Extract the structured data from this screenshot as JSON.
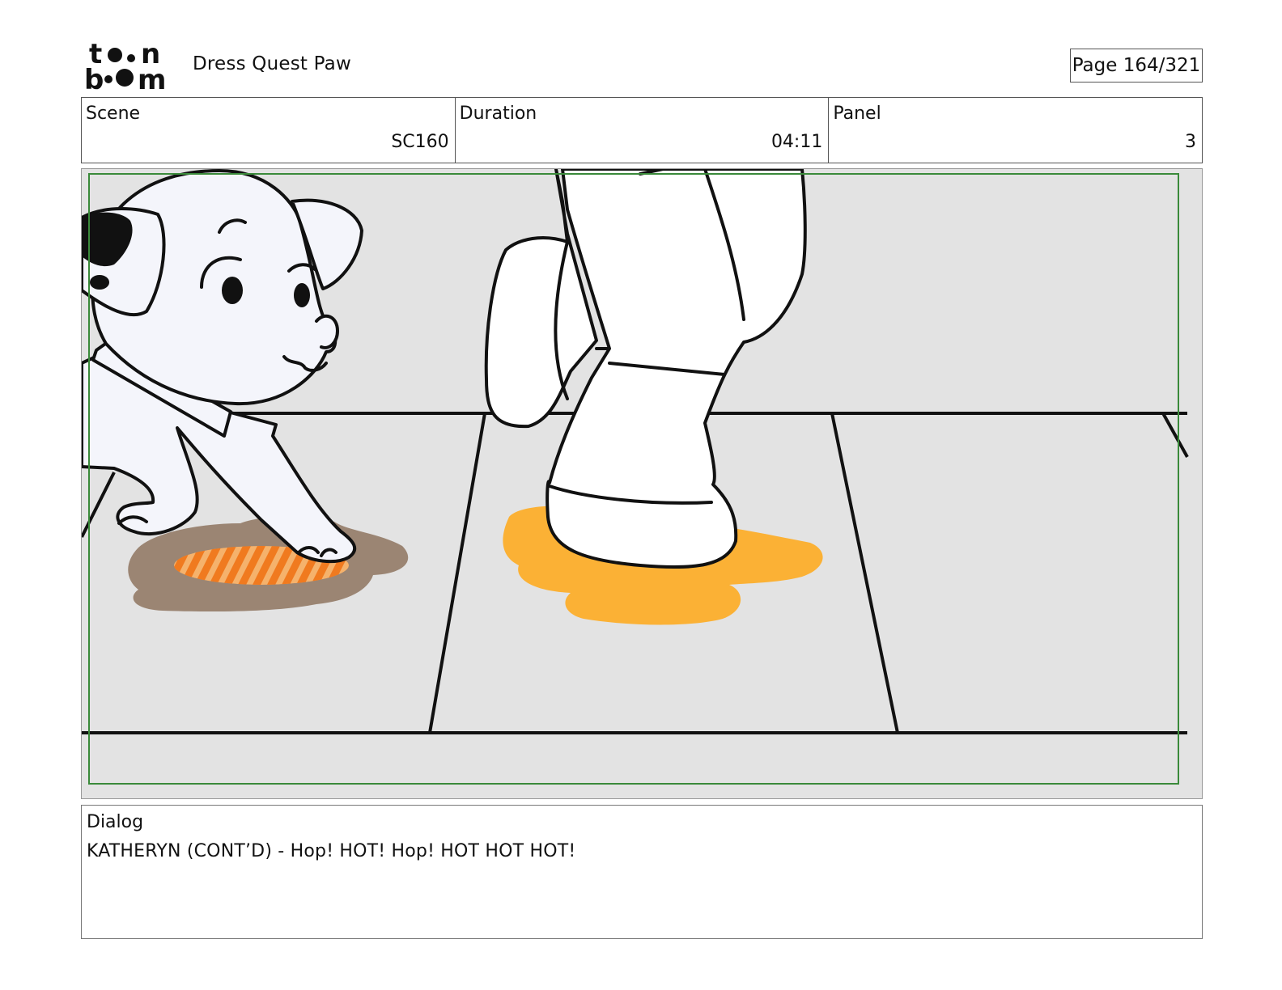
{
  "header": {
    "logo_text": "toon boom",
    "project_title": "Dress Quest Paw",
    "page_label": "Page 164/321"
  },
  "info": {
    "scene_label": "Scene",
    "scene_value": "SC160",
    "duration_label": "Duration",
    "duration_value": "04:11",
    "panel_label": "Panel",
    "panel_value": "3"
  },
  "panel": {
    "background_color": "#e3e3e3",
    "safe_frame_color": "#3a8a3a",
    "puddle_brown_color": "#9b8573",
    "puddle_orange_color": "#fbb135",
    "stripe_orange_color": "#f07a1f"
  },
  "dialog": {
    "label": "Dialog",
    "text": "KATHERYN (CONT’D) - Hop! HOT! Hop! HOT HOT HOT!"
  }
}
